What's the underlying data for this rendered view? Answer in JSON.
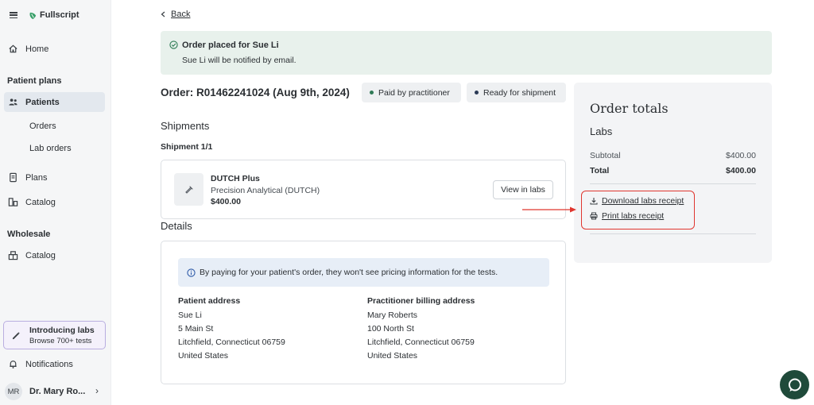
{
  "brand": {
    "name": "Fullscript"
  },
  "sidebar": {
    "home": "Home",
    "section_patient_plans": "Patient plans",
    "patients": "Patients",
    "orders": "Orders",
    "lab_orders": "Lab orders",
    "plans": "Plans",
    "catalog": "Catalog",
    "section_wholesale": "Wholesale",
    "wholesale_catalog": "Catalog",
    "promo_title": "Introducing labs",
    "promo_sub": "Browse 700+ tests",
    "notifications": "Notifications",
    "user_initials": "MR",
    "user_name": "Dr. Mary Ro..."
  },
  "back_label": "Back",
  "alert": {
    "title": "Order placed for Sue Li",
    "text": "Sue Li will be notified by email."
  },
  "order": {
    "title": "Order: R01462241024 (Aug 9th, 2024)",
    "badge_paid": "Paid by practitioner",
    "badge_ready": "Ready for shipment"
  },
  "shipments": {
    "heading": "Shipments",
    "sub": "Shipment 1/1",
    "item_name": "DUTCH Plus",
    "item_vendor": "Precision Analytical (DUTCH)",
    "item_price": "$400.00",
    "view_button": "View in labs"
  },
  "details": {
    "heading": "Details",
    "info": "By paying for your patient's order, they won't see pricing information for the tests.",
    "patient_head": "Patient address",
    "patient_lines": [
      "Sue Li",
      "5 Main St",
      "Litchfield, Connecticut 06759",
      "United States"
    ],
    "billing_head": "Practitioner billing address",
    "billing_lines": [
      "Mary Roberts",
      "100 North St",
      "Litchfield, Connecticut 06759",
      "United States"
    ]
  },
  "totals": {
    "title": "Order totals",
    "section": "Labs",
    "subtotal_label": "Subtotal",
    "subtotal_value": "$400.00",
    "total_label": "Total",
    "total_value": "$400.00",
    "download_receipt": "Download labs receipt",
    "print_receipt": "Print labs receipt"
  },
  "colors": {
    "accent_green": "#3aa06a",
    "highlight_red": "#e0362f",
    "alert_bg": "#e8f1ec",
    "chat_bg": "#1f4a3a"
  },
  "icons": [
    "menu-icon",
    "leaf-logo-icon",
    "home-icon",
    "patients-icon",
    "plans-icon",
    "catalog-icon",
    "wholesale-catalog-icon",
    "wand-icon",
    "bell-icon",
    "chevron-right-icon",
    "chevron-left-icon",
    "check-circle-icon",
    "test-tube-icon",
    "info-icon",
    "download-icon",
    "printer-icon",
    "chat-icon"
  ]
}
